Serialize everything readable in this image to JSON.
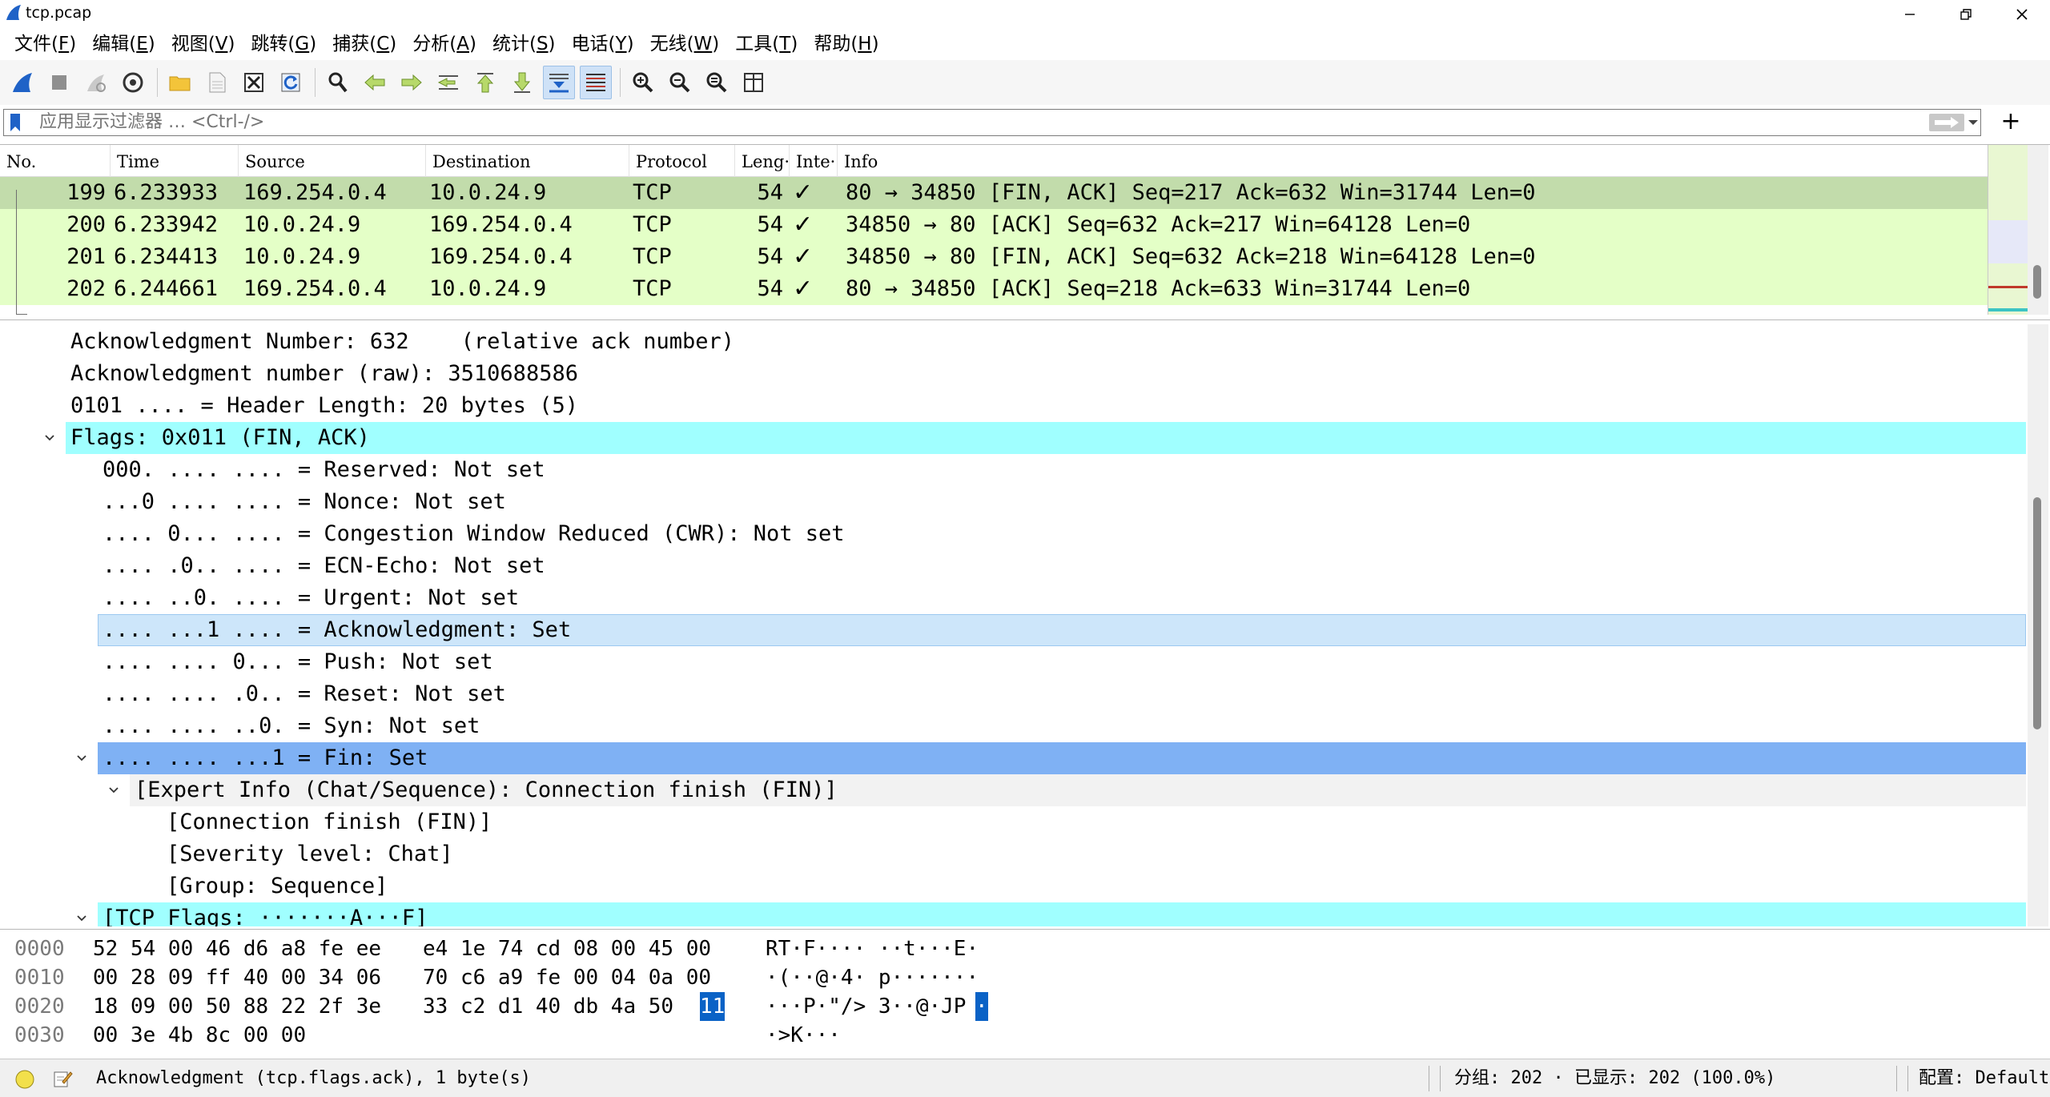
{
  "window": {
    "title": "tcp.pcap"
  },
  "menu": [
    {
      "label": "文件(",
      "key": "F",
      "end": ")"
    },
    {
      "label": "编辑(",
      "key": "E",
      "end": ")"
    },
    {
      "label": "视图(",
      "key": "V",
      "end": ")"
    },
    {
      "label": "跳转(",
      "key": "G",
      "end": ")"
    },
    {
      "label": "捕获(",
      "key": "C",
      "end": ")"
    },
    {
      "label": "分析(",
      "key": "A",
      "end": ")"
    },
    {
      "label": "统计(",
      "key": "S",
      "end": ")"
    },
    {
      "label": "电话(",
      "key": "Y",
      "end": ")"
    },
    {
      "label": "无线(",
      "key": "W",
      "end": ")"
    },
    {
      "label": "工具(",
      "key": "T",
      "end": ")"
    },
    {
      "label": "帮助(",
      "key": "H",
      "end": ")"
    }
  ],
  "toolbar": {
    "icons": [
      "shark-fin-start-icon",
      "stop-capture-icon",
      "restart-capture-icon",
      "capture-options-icon",
      "open-folder-icon",
      "save-file-icon",
      "close-file-icon",
      "reload-icon",
      "find-packet-icon",
      "go-back-icon",
      "go-forward-icon",
      "go-to-packet-icon",
      "first-packet-icon",
      "last-packet-icon",
      "autoscroll-icon",
      "colorize-icon",
      "zoom-in-icon",
      "zoom-out-icon",
      "normal-size-icon",
      "resize-columns-icon"
    ],
    "active": [
      "autoscroll-icon",
      "colorize-icon"
    ]
  },
  "filter": {
    "placeholder": "应用显示过滤器 … <Ctrl-/>"
  },
  "packet_list": {
    "columns": [
      "No.",
      "Time",
      "Source",
      "Destination",
      "Protocol",
      "Leng·",
      "Inte·",
      "Info"
    ],
    "rows": [
      {
        "no": "199",
        "time": "6.233933",
        "source": "169.254.0.4",
        "destination": "10.0.24.9",
        "protocol": "TCP",
        "length": "54",
        "intent": "✓",
        "info": "80 → 34850 [FIN, ACK] Seq=217 Ack=632 Win=31744 Len=0",
        "selected": true
      },
      {
        "no": "200",
        "time": "6.233942",
        "source": "10.0.24.9",
        "destination": "169.254.0.4",
        "protocol": "TCP",
        "length": "54",
        "intent": "✓",
        "info": "34850 → 80 [ACK] Seq=632 Ack=217 Win=64128 Len=0",
        "selected": false
      },
      {
        "no": "201",
        "time": "6.234413",
        "source": "10.0.24.9",
        "destination": "169.254.0.4",
        "protocol": "TCP",
        "length": "54",
        "intent": "✓",
        "info": "34850 → 80 [FIN, ACK] Seq=632 Ack=218 Win=64128 Len=0",
        "selected": false
      },
      {
        "no": "202",
        "time": "6.244661",
        "source": "169.254.0.4",
        "destination": "10.0.24.9",
        "protocol": "TCP",
        "length": "54",
        "intent": "✓",
        "info": "80 → 34850 [ACK] Seq=218 Ack=633 Win=31744 Len=0",
        "selected": false
      }
    ],
    "colors": {
      "row": "#e4ffc7",
      "selected": "#c2dcab"
    }
  },
  "details": {
    "rows": [
      {
        "text": "Acknowledgment Number: 632    (relative ack number)",
        "indent": 0,
        "expander": "none",
        "style": "plain"
      },
      {
        "text": "Acknowledgment number (raw): 3510688586",
        "indent": 0,
        "expander": "none",
        "style": "plain"
      },
      {
        "text": "0101 .... = Header Length: 20 bytes (5)",
        "indent": 0,
        "expander": "none",
        "style": "plain"
      },
      {
        "text": "Flags: 0x011 (FIN, ACK)",
        "indent": 0,
        "expander": "open",
        "style": "cyan"
      },
      {
        "text": "000. .... .... = Reserved: Not set",
        "indent": 1,
        "expander": "none",
        "style": "plain"
      },
      {
        "text": "...0 .... .... = Nonce: Not set",
        "indent": 1,
        "expander": "none",
        "style": "plain"
      },
      {
        "text": ".... 0... .... = Congestion Window Reduced (CWR): Not set",
        "indent": 1,
        "expander": "none",
        "style": "plain"
      },
      {
        "text": ".... .0.. .... = ECN-Echo: Not set",
        "indent": 1,
        "expander": "none",
        "style": "plain"
      },
      {
        "text": ".... ..0. .... = Urgent: Not set",
        "indent": 1,
        "expander": "none",
        "style": "plain"
      },
      {
        "text": ".... ...1 .... = Acknowledgment: Set",
        "indent": 1,
        "expander": "none",
        "style": "hover"
      },
      {
        "text": ".... .... 0... = Push: Not set",
        "indent": 1,
        "expander": "none",
        "style": "plain"
      },
      {
        "text": ".... .... .0.. = Reset: Not set",
        "indent": 1,
        "expander": "none",
        "style": "plain"
      },
      {
        "text": ".... .... ..0. = Syn: Not set",
        "indent": 1,
        "expander": "none",
        "style": "plain"
      },
      {
        "text": ".... .... ...1 = Fin: Set",
        "indent": 1,
        "expander": "open",
        "style": "selected"
      },
      {
        "text": "[Expert Info (Chat/Sequence): Connection finish (FIN)]",
        "indent": 2,
        "expander": "open",
        "style": "gray"
      },
      {
        "text": "[Connection finish (FIN)]",
        "indent": 3,
        "expander": "none",
        "style": "plain"
      },
      {
        "text": "[Severity level: Chat]",
        "indent": 3,
        "expander": "none",
        "style": "plain"
      },
      {
        "text": "[Group: Sequence]",
        "indent": 3,
        "expander": "none",
        "style": "plain"
      },
      {
        "text": "[TCP Flags: ·······A···F]",
        "indent": 1,
        "expander": "open",
        "style": "cyan"
      }
    ],
    "colors": {
      "cyan": "#a0ffff",
      "hover": "#cde6fa",
      "selected": "#7fb1f4",
      "gray": "#f2f2f2"
    }
  },
  "bytes": {
    "rows": [
      {
        "offset": "0000",
        "hex_a": "52 54 00 46 d6 a8 fe ee",
        "hex_b": "e4 1e 74 cd 08 00 45 00",
        "ascii": "RT·F···· ··t···E·"
      },
      {
        "offset": "0010",
        "hex_a": "00 28 09 ff 40 00 34 06",
        "hex_b": "70 c6 a9 fe 00 04 0a 00",
        "ascii": "·(··@·4· p·······"
      },
      {
        "offset": "0020",
        "hex_a": "18 09 00 50 88 22 2f 3e",
        "hex_b": "33 c2 d1 40 db 4a 50",
        "hex_b_hl": "11",
        "ascii": "···P·\"/> 3··@·JP",
        "ascii_hl": "·"
      },
      {
        "offset": "0030",
        "hex_a": "00 3e 4b 8c 00 00",
        "hex_b": "",
        "ascii": "·>K···"
      }
    ]
  },
  "status": {
    "left": "Acknowledgment (tcp.flags.ack), 1 byte(s)",
    "packets": "分组: 202 · 已显示: 202 (100.0%)",
    "profile": "配置: Default"
  }
}
